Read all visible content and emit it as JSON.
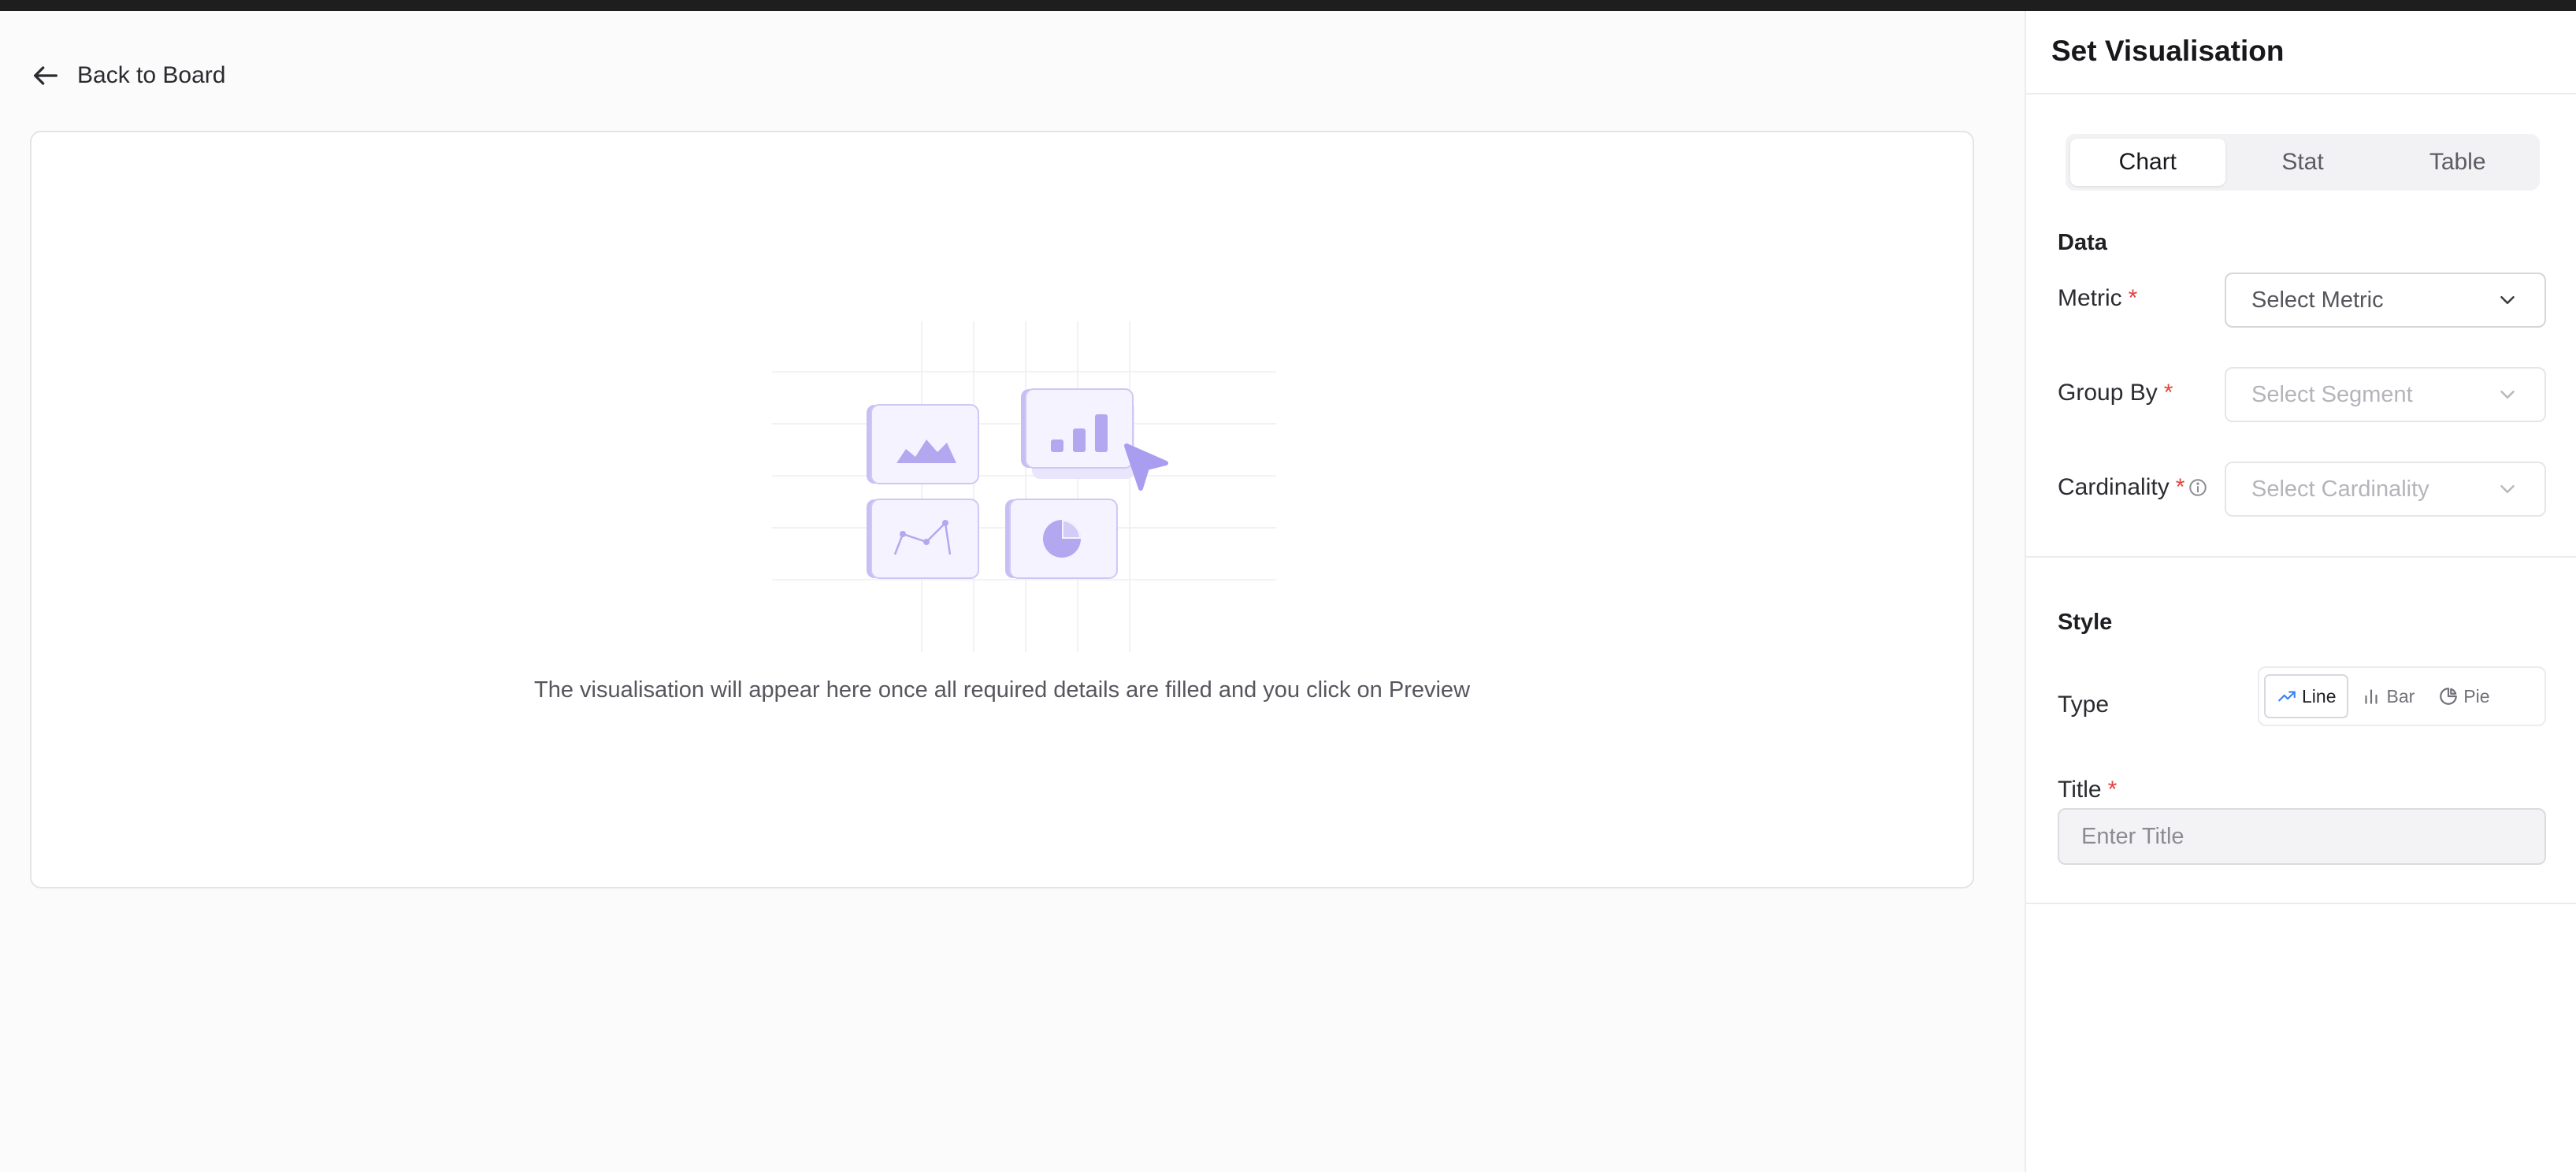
{
  "main": {
    "back_label": "Back to Board",
    "empty_message": "The visualisation will appear here once all required details are filled and you click on Preview"
  },
  "panel": {
    "title": "Set Visualisation",
    "tabs": [
      {
        "label": "Chart",
        "active": true
      },
      {
        "label": "Stat",
        "active": false
      },
      {
        "label": "Table",
        "active": false
      }
    ],
    "data_section": {
      "heading": "Data",
      "metric": {
        "label": "Metric",
        "required_mark": "*",
        "placeholder": "Select Metric"
      },
      "group_by": {
        "label": "Group By",
        "required_mark": "*",
        "placeholder": "Select Segment"
      },
      "cardinality": {
        "label": "Cardinality",
        "required_mark": "*",
        "placeholder": "Select Cardinality"
      }
    },
    "style_section": {
      "heading": "Style",
      "type_label": "Type",
      "types": [
        {
          "label": "Line",
          "icon": "trend-line-icon",
          "active": true
        },
        {
          "label": "Bar",
          "icon": "bar-chart-icon",
          "active": false
        },
        {
          "label": "Pie",
          "icon": "pie-chart-icon",
          "active": false
        }
      ],
      "title_label": "Title",
      "title_required_mark": "*",
      "title_placeholder": "Enter Title"
    }
  },
  "colors": {
    "accent": "#3b82f6",
    "required": "#e0443e",
    "illustration_purple": "#a99df0"
  }
}
